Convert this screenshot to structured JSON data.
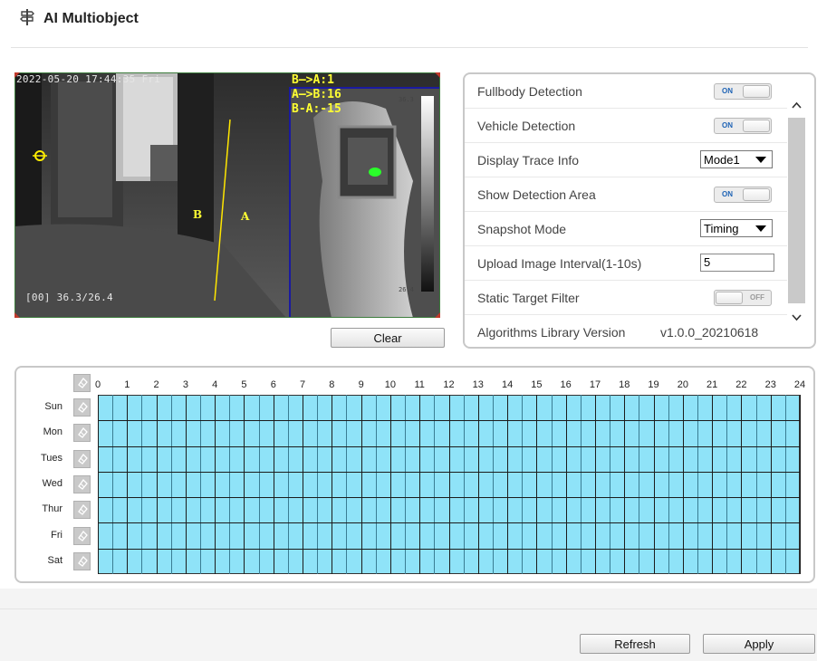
{
  "header": {
    "title": "AI Multiobject"
  },
  "video": {
    "timestamp": "2022-05-20 17:44:35 Fri",
    "temperature_readout": "[00] 36.3/26.4",
    "line_label_b": "B",
    "line_label_a": "A",
    "counts": [
      "B—>A:1",
      "A—>B:16",
      "B-A:-15"
    ],
    "scale_max": "36.3",
    "scale_min": "26.4",
    "clear_label": "Clear"
  },
  "settings": {
    "rows": [
      {
        "label": "Fullbody Detection",
        "toggle": "ON"
      },
      {
        "label": "Vehicle Detection",
        "toggle": "ON"
      },
      {
        "label": "Display Trace Info",
        "select": "Mode1"
      },
      {
        "label": "Show Detection Area",
        "toggle": "ON"
      },
      {
        "label": "Snapshot Mode",
        "select": "Timing"
      },
      {
        "label": "Upload Image Interval(1-10s)",
        "input": "5"
      },
      {
        "label": "Static Target Filter",
        "toggle": "OFF"
      },
      {
        "label": "Algorithms Library Version",
        "value": "v1.0.0_20210618"
      }
    ]
  },
  "schedule": {
    "hours": [
      "0",
      "1",
      "2",
      "3",
      "4",
      "5",
      "6",
      "7",
      "8",
      "9",
      "10",
      "11",
      "12",
      "13",
      "14",
      "15",
      "16",
      "17",
      "18",
      "19",
      "20",
      "21",
      "22",
      "23",
      "24"
    ],
    "days": [
      "Sun",
      "Mon",
      "Tues",
      "Wed",
      "Thur",
      "Fri",
      "Sat"
    ],
    "fill_color": "#8fe3f8"
  },
  "footer": {
    "refresh_label": "Refresh",
    "apply_label": "Apply"
  },
  "colors": {
    "accent_on": "#1e63b5",
    "osd_yellow": "#ffff33",
    "detect_box": "#1a1aa0"
  }
}
